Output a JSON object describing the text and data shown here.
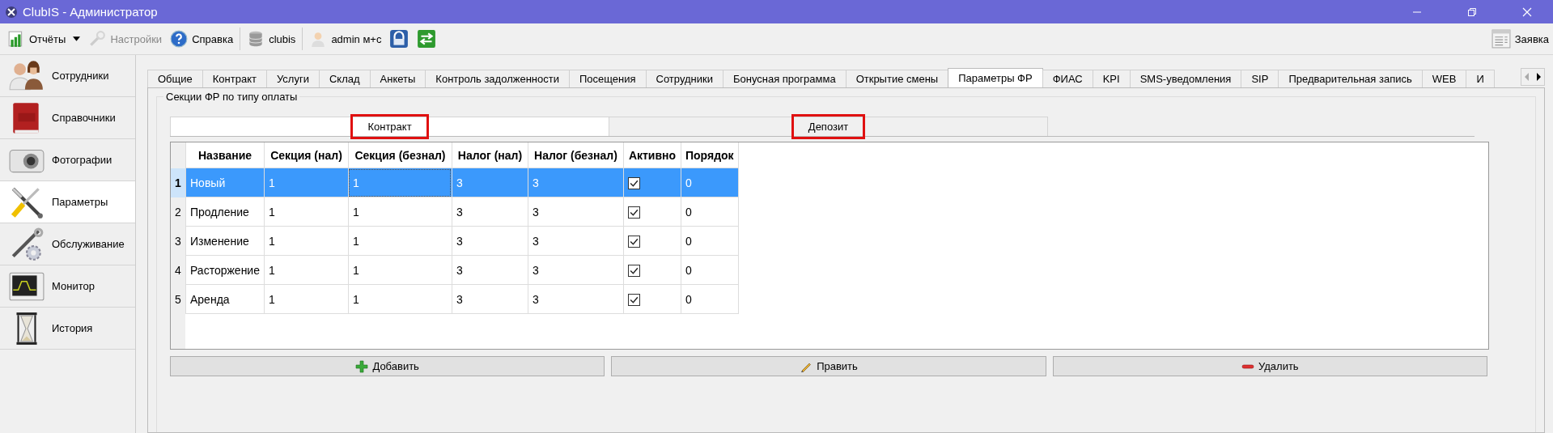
{
  "window": {
    "title": "ClubIS - Администратор"
  },
  "toolbar": [
    {
      "label": "Отчёты",
      "kind": "reports",
      "disabled": false
    },
    {
      "label": "Настройки",
      "kind": "settings",
      "disabled": true
    },
    {
      "label": "Справка",
      "kind": "help",
      "disabled": false
    },
    {
      "label": "clubis",
      "kind": "db",
      "disabled": false
    },
    {
      "label": "admin м+с",
      "kind": "user",
      "disabled": false
    },
    {
      "kind": "lock",
      "disabled": false
    },
    {
      "kind": "switch",
      "disabled": false
    }
  ],
  "request_button": {
    "label": "Заявка"
  },
  "sidebar": {
    "items": [
      {
        "label": "Сотрудники",
        "kind": "people",
        "selected": false
      },
      {
        "label": "Справочники",
        "kind": "book",
        "selected": false
      },
      {
        "label": "Фотографии",
        "kind": "camera",
        "selected": false
      },
      {
        "label": "Параметры",
        "kind": "tools",
        "selected": true
      },
      {
        "label": "Обслуживание",
        "kind": "service",
        "selected": false
      },
      {
        "label": "Монитор",
        "kind": "monitor",
        "selected": false
      },
      {
        "label": "История",
        "kind": "hourglass",
        "selected": false
      }
    ]
  },
  "tabs": [
    {
      "label": "Общие",
      "selected": false
    },
    {
      "label": "Контракт",
      "selected": false
    },
    {
      "label": "Услуги",
      "selected": false
    },
    {
      "label": "Склад",
      "selected": false
    },
    {
      "label": "Анкеты",
      "selected": false
    },
    {
      "label": "Контроль задолженности",
      "selected": false
    },
    {
      "label": "Посещения",
      "selected": false
    },
    {
      "label": "Сотрудники",
      "selected": false
    },
    {
      "label": "Бонусная программа",
      "selected": false
    },
    {
      "label": "Открытие смены",
      "selected": false
    },
    {
      "label": "Параметры ФР",
      "selected": true
    },
    {
      "label": "ФИАС",
      "selected": false
    },
    {
      "label": "KPI",
      "selected": false
    },
    {
      "label": "SMS-уведомления",
      "selected": false
    },
    {
      "label": "SIP",
      "selected": false
    },
    {
      "label": "Предварительная запись",
      "selected": false
    },
    {
      "label": "WEB",
      "selected": false
    },
    {
      "label": "И",
      "selected": false
    }
  ],
  "group": {
    "title": "Секции ФР по типу оплаты",
    "subtabs": [
      {
        "label": "Контракт",
        "selected": true,
        "highlighted": true
      },
      {
        "label": "Депозит",
        "selected": false,
        "highlighted": true
      }
    ],
    "table": {
      "columns": [
        "Название",
        "Секция (нал)",
        "Секция (безнал)",
        "Налог (нал)",
        "Налог (безнал)",
        "Активно",
        "Порядок"
      ],
      "rows": [
        {
          "number": "1",
          "name": "Новый",
          "section_cash": "1",
          "section_card": "1",
          "tax_cash": "3",
          "tax_card": "3",
          "active": true,
          "order": "0",
          "selected": true
        },
        {
          "number": "2",
          "name": "Продление",
          "section_cash": "1",
          "section_card": "1",
          "tax_cash": "3",
          "tax_card": "3",
          "active": true,
          "order": "0",
          "selected": false
        },
        {
          "number": "3",
          "name": "Изменение",
          "section_cash": "1",
          "section_card": "1",
          "tax_cash": "3",
          "tax_card": "3",
          "active": true,
          "order": "0",
          "selected": false
        },
        {
          "number": "4",
          "name": "Расторжение",
          "section_cash": "1",
          "section_card": "1",
          "tax_cash": "3",
          "tax_card": "3",
          "active": true,
          "order": "0",
          "selected": false
        },
        {
          "number": "5",
          "name": "Аренда",
          "section_cash": "1",
          "section_card": "1",
          "tax_cash": "3",
          "tax_card": "3",
          "active": true,
          "order": "0",
          "selected": false
        }
      ]
    },
    "buttons": [
      {
        "label": "Добавить",
        "kind": "add"
      },
      {
        "label": "Править",
        "kind": "edit"
      },
      {
        "label": "Удалить",
        "kind": "delete"
      }
    ]
  }
}
